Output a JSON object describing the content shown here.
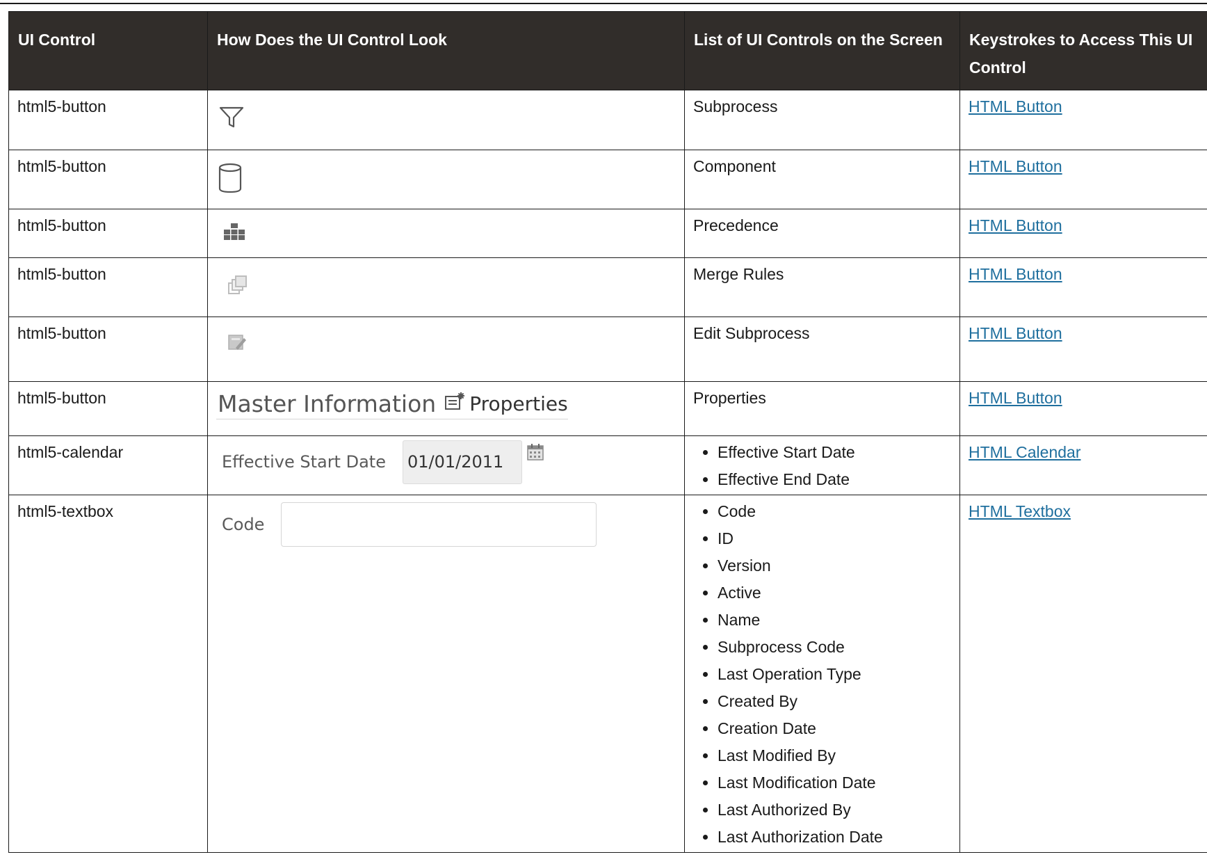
{
  "headers": [
    "UI Control",
    "How Does the UI Control Look",
    "List of UI Controls on the Screen",
    "Keystrokes to Access This UI Control"
  ],
  "rows": [
    {
      "control": "html5-button",
      "look_icon": "filter-icon",
      "items": [
        "Subprocess"
      ],
      "link": "HTML Button"
    },
    {
      "control": "html5-button",
      "look_icon": "database-icon",
      "items": [
        "Component"
      ],
      "link": "HTML Button"
    },
    {
      "control": "html5-button",
      "look_icon": "hierarchy-icon",
      "items": [
        "Precedence"
      ],
      "link": "HTML Button"
    },
    {
      "control": "html5-button",
      "look_icon": "merge-icon",
      "items": [
        "Merge Rules"
      ],
      "link": "HTML Button"
    },
    {
      "control": "html5-button",
      "look_icon": "edit-icon",
      "items": [
        "Edit Subprocess"
      ],
      "link": "HTML Button"
    },
    {
      "control": "html5-button",
      "look_title": "Master Information",
      "look_label": "Properties",
      "items": [
        "Properties"
      ],
      "link": "HTML Button"
    },
    {
      "control": "html5-calendar",
      "look_label": "Effective Start Date",
      "look_value": "01/01/2011",
      "items": [
        "Effective Start Date",
        "Effective End Date"
      ],
      "link": "HTML Calendar"
    },
    {
      "control": "html5-textbox",
      "look_label": "Code",
      "items": [
        "Code",
        "ID",
        "Version",
        "Active",
        "Name",
        "Subprocess Code",
        "Last Operation Type",
        "Created By",
        "Creation Date",
        "Last Modified By",
        "Last Modification Date",
        "Last Authorized By",
        "Last Authorization Date"
      ],
      "link": "HTML Textbox"
    }
  ],
  "colors": {
    "header_bg": "#312d2a",
    "header_text": "#ffffff",
    "link": "#1f6f9e"
  }
}
